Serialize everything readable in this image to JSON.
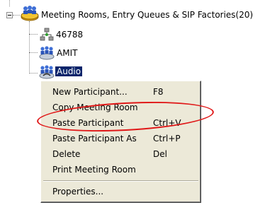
{
  "tree": {
    "root": {
      "label": "Meeting Rooms, Entry Queues & SIP Factories(20)"
    },
    "children": [
      {
        "label": "46788",
        "icon": "sip-factory-icon"
      },
      {
        "label": "AMIT",
        "icon": "meeting-room-icon"
      },
      {
        "label": "Audio",
        "icon": "audio-meeting-room-icon",
        "selected": true
      }
    ]
  },
  "context_menu": {
    "items": [
      {
        "label": "New Participant...",
        "shortcut": "F8"
      },
      {
        "label": "Copy Meeting Room",
        "shortcut": ""
      },
      {
        "label": "Paste Participant",
        "shortcut": "Ctrl+V"
      },
      {
        "label": "Paste Participant As",
        "shortcut": "Ctrl+P"
      },
      {
        "label": "Delete",
        "shortcut": "Del"
      },
      {
        "label": "Print Meeting Room",
        "shortcut": ""
      },
      {
        "label": "Properties...",
        "shortcut": ""
      }
    ]
  },
  "annotation": {
    "color": "#e01818"
  },
  "colors": {
    "menu_bg": "#ece9d8",
    "selection_bg": "#0a246a"
  }
}
